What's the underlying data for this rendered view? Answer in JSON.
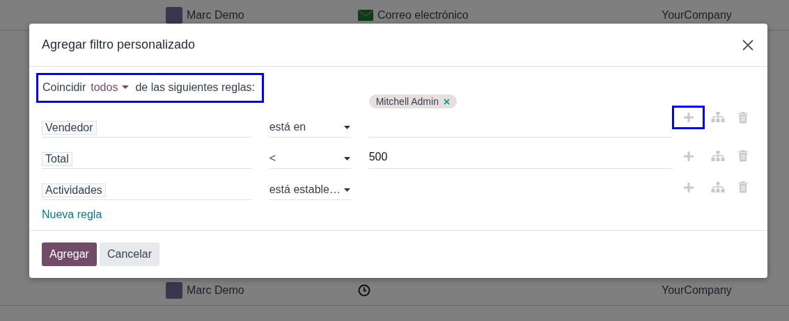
{
  "background_list": {
    "rows": [
      {
        "name": "Marc Demo",
        "activity": {
          "kind": "email",
          "label": "Correo electrónico"
        },
        "company": "YourCompany"
      },
      {
        "name": "Marc Demo",
        "activity": {
          "kind": "clock"
        },
        "company": "YourCompany"
      }
    ]
  },
  "dialog": {
    "title": "Agregar filtro personalizado",
    "match": {
      "prefix": "Coincidir",
      "selector": "todos",
      "suffix": "de las siguientes reglas:",
      "highlighted": true
    },
    "rules": [
      {
        "field": "Vendedor",
        "operator": "está en",
        "value": {
          "kind": "tags",
          "tags": [
            "Mitchell Admin"
          ]
        },
        "add_highlighted": true
      },
      {
        "field": "Total",
        "operator": "<",
        "value": {
          "kind": "text",
          "text": "500"
        },
        "add_highlighted": false
      },
      {
        "field": "Actividades",
        "operator": "está estable…",
        "value": {
          "kind": "none"
        },
        "add_highlighted": false
      }
    ],
    "new_rule": "Nueva regla",
    "buttons": [
      {
        "label": "Agregar",
        "kind": "primary"
      },
      {
        "label": "Cancelar",
        "kind": "secondary"
      }
    ]
  }
}
